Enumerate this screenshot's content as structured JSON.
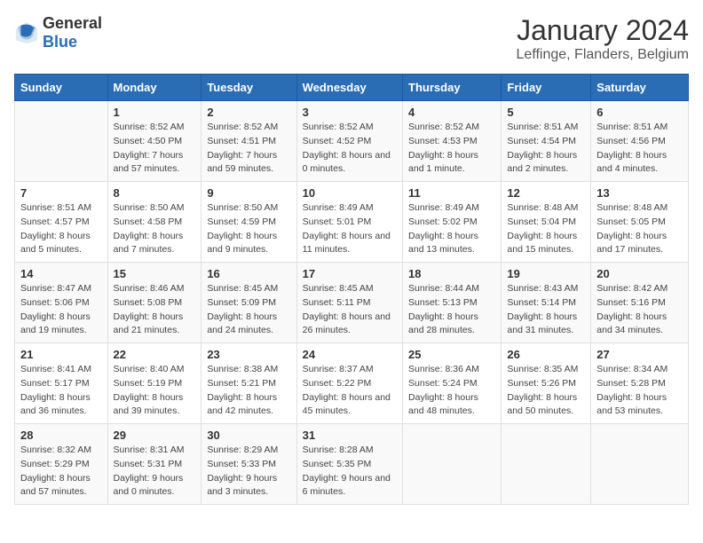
{
  "logo": {
    "general": "General",
    "blue": "Blue"
  },
  "header": {
    "month": "January 2024",
    "location": "Leffinge, Flanders, Belgium"
  },
  "weekdays": [
    "Sunday",
    "Monday",
    "Tuesday",
    "Wednesday",
    "Thursday",
    "Friday",
    "Saturday"
  ],
  "weeks": [
    [
      {
        "day": "",
        "sunrise": "",
        "sunset": "",
        "daylight": ""
      },
      {
        "day": "1",
        "sunrise": "Sunrise: 8:52 AM",
        "sunset": "Sunset: 4:50 PM",
        "daylight": "Daylight: 7 hours and 57 minutes."
      },
      {
        "day": "2",
        "sunrise": "Sunrise: 8:52 AM",
        "sunset": "Sunset: 4:51 PM",
        "daylight": "Daylight: 7 hours and 59 minutes."
      },
      {
        "day": "3",
        "sunrise": "Sunrise: 8:52 AM",
        "sunset": "Sunset: 4:52 PM",
        "daylight": "Daylight: 8 hours and 0 minutes."
      },
      {
        "day": "4",
        "sunrise": "Sunrise: 8:52 AM",
        "sunset": "Sunset: 4:53 PM",
        "daylight": "Daylight: 8 hours and 1 minute."
      },
      {
        "day": "5",
        "sunrise": "Sunrise: 8:51 AM",
        "sunset": "Sunset: 4:54 PM",
        "daylight": "Daylight: 8 hours and 2 minutes."
      },
      {
        "day": "6",
        "sunrise": "Sunrise: 8:51 AM",
        "sunset": "Sunset: 4:56 PM",
        "daylight": "Daylight: 8 hours and 4 minutes."
      }
    ],
    [
      {
        "day": "7",
        "sunrise": "Sunrise: 8:51 AM",
        "sunset": "Sunset: 4:57 PM",
        "daylight": "Daylight: 8 hours and 5 minutes."
      },
      {
        "day": "8",
        "sunrise": "Sunrise: 8:50 AM",
        "sunset": "Sunset: 4:58 PM",
        "daylight": "Daylight: 8 hours and 7 minutes."
      },
      {
        "day": "9",
        "sunrise": "Sunrise: 8:50 AM",
        "sunset": "Sunset: 4:59 PM",
        "daylight": "Daylight: 8 hours and 9 minutes."
      },
      {
        "day": "10",
        "sunrise": "Sunrise: 8:49 AM",
        "sunset": "Sunset: 5:01 PM",
        "daylight": "Daylight: 8 hours and 11 minutes."
      },
      {
        "day": "11",
        "sunrise": "Sunrise: 8:49 AM",
        "sunset": "Sunset: 5:02 PM",
        "daylight": "Daylight: 8 hours and 13 minutes."
      },
      {
        "day": "12",
        "sunrise": "Sunrise: 8:48 AM",
        "sunset": "Sunset: 5:04 PM",
        "daylight": "Daylight: 8 hours and 15 minutes."
      },
      {
        "day": "13",
        "sunrise": "Sunrise: 8:48 AM",
        "sunset": "Sunset: 5:05 PM",
        "daylight": "Daylight: 8 hours and 17 minutes."
      }
    ],
    [
      {
        "day": "14",
        "sunrise": "Sunrise: 8:47 AM",
        "sunset": "Sunset: 5:06 PM",
        "daylight": "Daylight: 8 hours and 19 minutes."
      },
      {
        "day": "15",
        "sunrise": "Sunrise: 8:46 AM",
        "sunset": "Sunset: 5:08 PM",
        "daylight": "Daylight: 8 hours and 21 minutes."
      },
      {
        "day": "16",
        "sunrise": "Sunrise: 8:45 AM",
        "sunset": "Sunset: 5:09 PM",
        "daylight": "Daylight: 8 hours and 24 minutes."
      },
      {
        "day": "17",
        "sunrise": "Sunrise: 8:45 AM",
        "sunset": "Sunset: 5:11 PM",
        "daylight": "Daylight: 8 hours and 26 minutes."
      },
      {
        "day": "18",
        "sunrise": "Sunrise: 8:44 AM",
        "sunset": "Sunset: 5:13 PM",
        "daylight": "Daylight: 8 hours and 28 minutes."
      },
      {
        "day": "19",
        "sunrise": "Sunrise: 8:43 AM",
        "sunset": "Sunset: 5:14 PM",
        "daylight": "Daylight: 8 hours and 31 minutes."
      },
      {
        "day": "20",
        "sunrise": "Sunrise: 8:42 AM",
        "sunset": "Sunset: 5:16 PM",
        "daylight": "Daylight: 8 hours and 34 minutes."
      }
    ],
    [
      {
        "day": "21",
        "sunrise": "Sunrise: 8:41 AM",
        "sunset": "Sunset: 5:17 PM",
        "daylight": "Daylight: 8 hours and 36 minutes."
      },
      {
        "day": "22",
        "sunrise": "Sunrise: 8:40 AM",
        "sunset": "Sunset: 5:19 PM",
        "daylight": "Daylight: 8 hours and 39 minutes."
      },
      {
        "day": "23",
        "sunrise": "Sunrise: 8:38 AM",
        "sunset": "Sunset: 5:21 PM",
        "daylight": "Daylight: 8 hours and 42 minutes."
      },
      {
        "day": "24",
        "sunrise": "Sunrise: 8:37 AM",
        "sunset": "Sunset: 5:22 PM",
        "daylight": "Daylight: 8 hours and 45 minutes."
      },
      {
        "day": "25",
        "sunrise": "Sunrise: 8:36 AM",
        "sunset": "Sunset: 5:24 PM",
        "daylight": "Daylight: 8 hours and 48 minutes."
      },
      {
        "day": "26",
        "sunrise": "Sunrise: 8:35 AM",
        "sunset": "Sunset: 5:26 PM",
        "daylight": "Daylight: 8 hours and 50 minutes."
      },
      {
        "day": "27",
        "sunrise": "Sunrise: 8:34 AM",
        "sunset": "Sunset: 5:28 PM",
        "daylight": "Daylight: 8 hours and 53 minutes."
      }
    ],
    [
      {
        "day": "28",
        "sunrise": "Sunrise: 8:32 AM",
        "sunset": "Sunset: 5:29 PM",
        "daylight": "Daylight: 8 hours and 57 minutes."
      },
      {
        "day": "29",
        "sunrise": "Sunrise: 8:31 AM",
        "sunset": "Sunset: 5:31 PM",
        "daylight": "Daylight: 9 hours and 0 minutes."
      },
      {
        "day": "30",
        "sunrise": "Sunrise: 8:29 AM",
        "sunset": "Sunset: 5:33 PM",
        "daylight": "Daylight: 9 hours and 3 minutes."
      },
      {
        "day": "31",
        "sunrise": "Sunrise: 8:28 AM",
        "sunset": "Sunset: 5:35 PM",
        "daylight": "Daylight: 9 hours and 6 minutes."
      },
      {
        "day": "",
        "sunrise": "",
        "sunset": "",
        "daylight": ""
      },
      {
        "day": "",
        "sunrise": "",
        "sunset": "",
        "daylight": ""
      },
      {
        "day": "",
        "sunrise": "",
        "sunset": "",
        "daylight": ""
      }
    ]
  ]
}
